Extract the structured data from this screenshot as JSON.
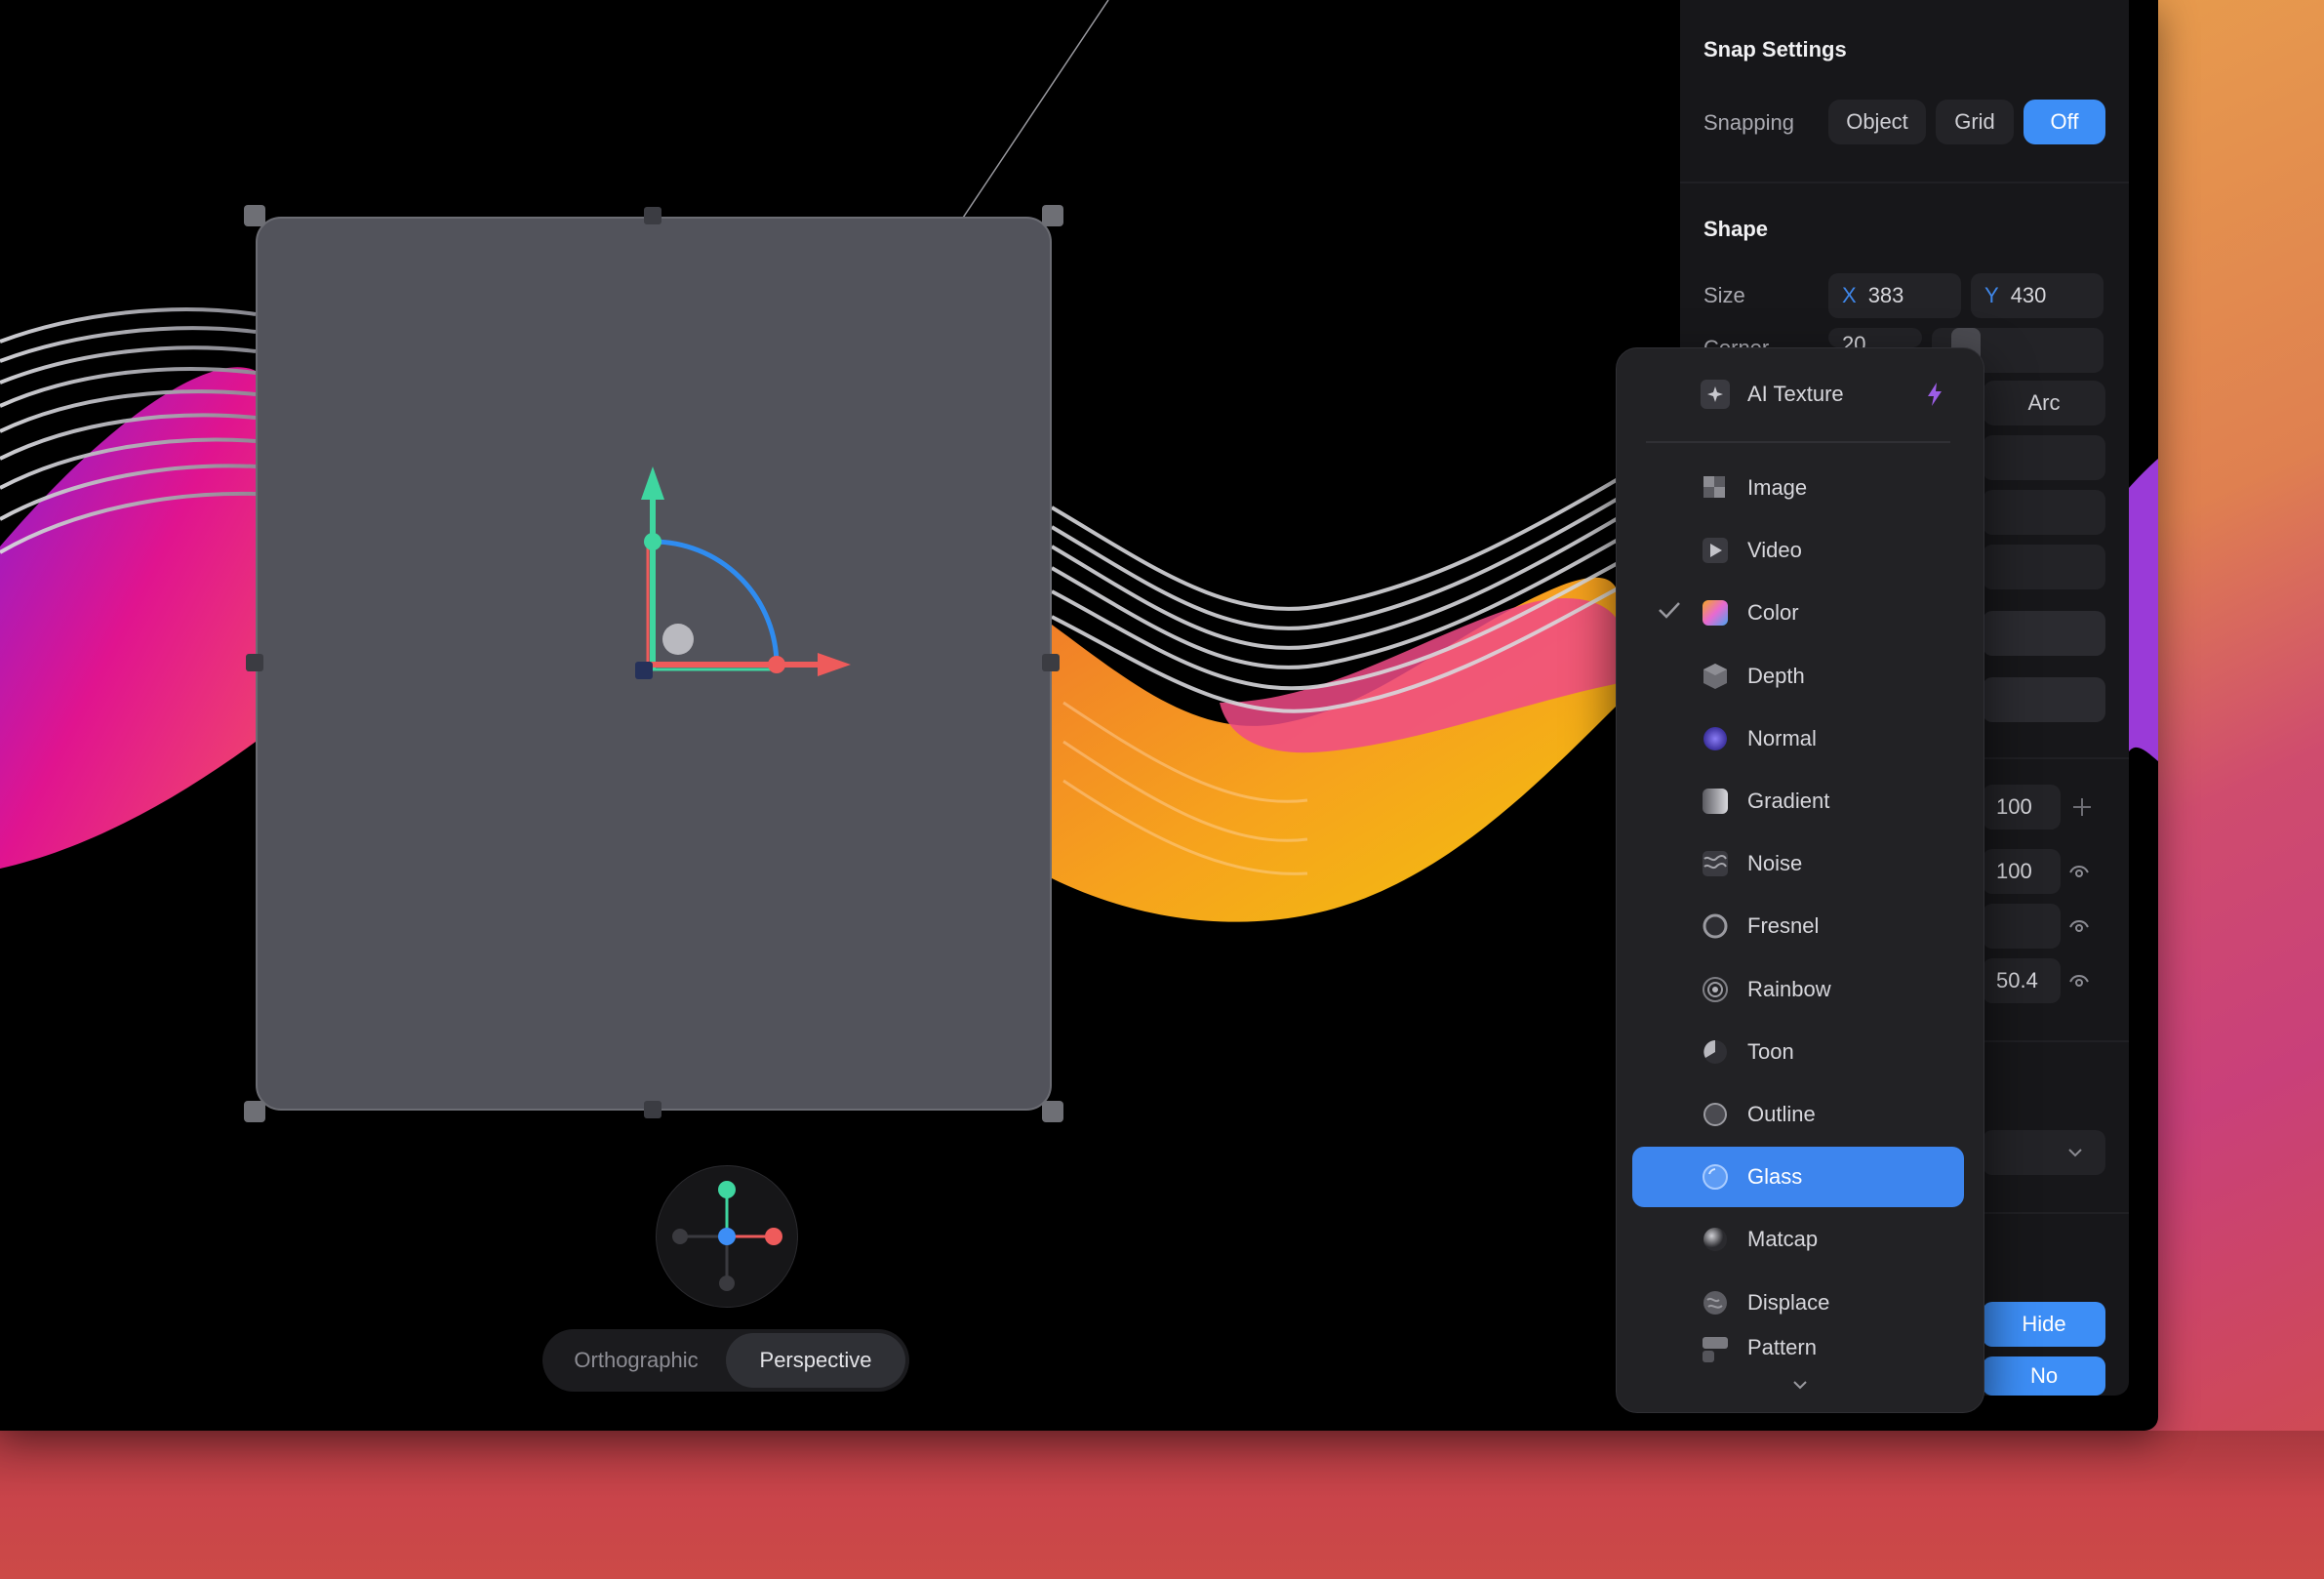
{
  "view": {
    "modes": [
      "Orthographic",
      "Perspective"
    ],
    "active_mode": "Perspective"
  },
  "panel": {
    "snap": {
      "title": "Snap Settings",
      "label": "Snapping",
      "options": [
        "Object",
        "Grid",
        "Off"
      ],
      "selected": "Off"
    },
    "shape": {
      "title": "Shape",
      "size_label": "Size",
      "size_x_axis": "X",
      "size_x": "383",
      "size_y_axis": "Y",
      "size_y": "430",
      "corner_label": "Corner",
      "corner_value": "20",
      "arc_label": "Arc"
    },
    "layers": {
      "value_1": "100",
      "value_2": "100",
      "value_4": "50.4"
    },
    "buttons": {
      "hide": "Hide",
      "no": "No"
    }
  },
  "dropdown": {
    "header": "AI Texture",
    "items": [
      {
        "label": "Image",
        "icon": "image-icon"
      },
      {
        "label": "Video",
        "icon": "video-icon"
      },
      {
        "label": "Color",
        "icon": "color-icon"
      },
      {
        "label": "Depth",
        "icon": "depth-icon"
      },
      {
        "label": "Normal",
        "icon": "normal-icon"
      },
      {
        "label": "Gradient",
        "icon": "gradient-icon"
      },
      {
        "label": "Noise",
        "icon": "noise-icon"
      },
      {
        "label": "Fresnel",
        "icon": "fresnel-icon"
      },
      {
        "label": "Rainbow",
        "icon": "rainbow-icon"
      },
      {
        "label": "Toon",
        "icon": "toon-icon"
      },
      {
        "label": "Outline",
        "icon": "outline-icon"
      },
      {
        "label": "Glass",
        "icon": "glass-icon"
      },
      {
        "label": "Matcap",
        "icon": "matcap-icon"
      },
      {
        "label": "Displace",
        "icon": "displace-icon"
      },
      {
        "label": "Pattern",
        "icon": "pattern-icon"
      }
    ],
    "checked": "Color",
    "highlighted": "Glass"
  },
  "colors": {
    "accent": "#3d8ef6",
    "axis_x": "#ee5b5b",
    "axis_y": "#3fd6a0",
    "rotate": "#2f8cf0"
  }
}
